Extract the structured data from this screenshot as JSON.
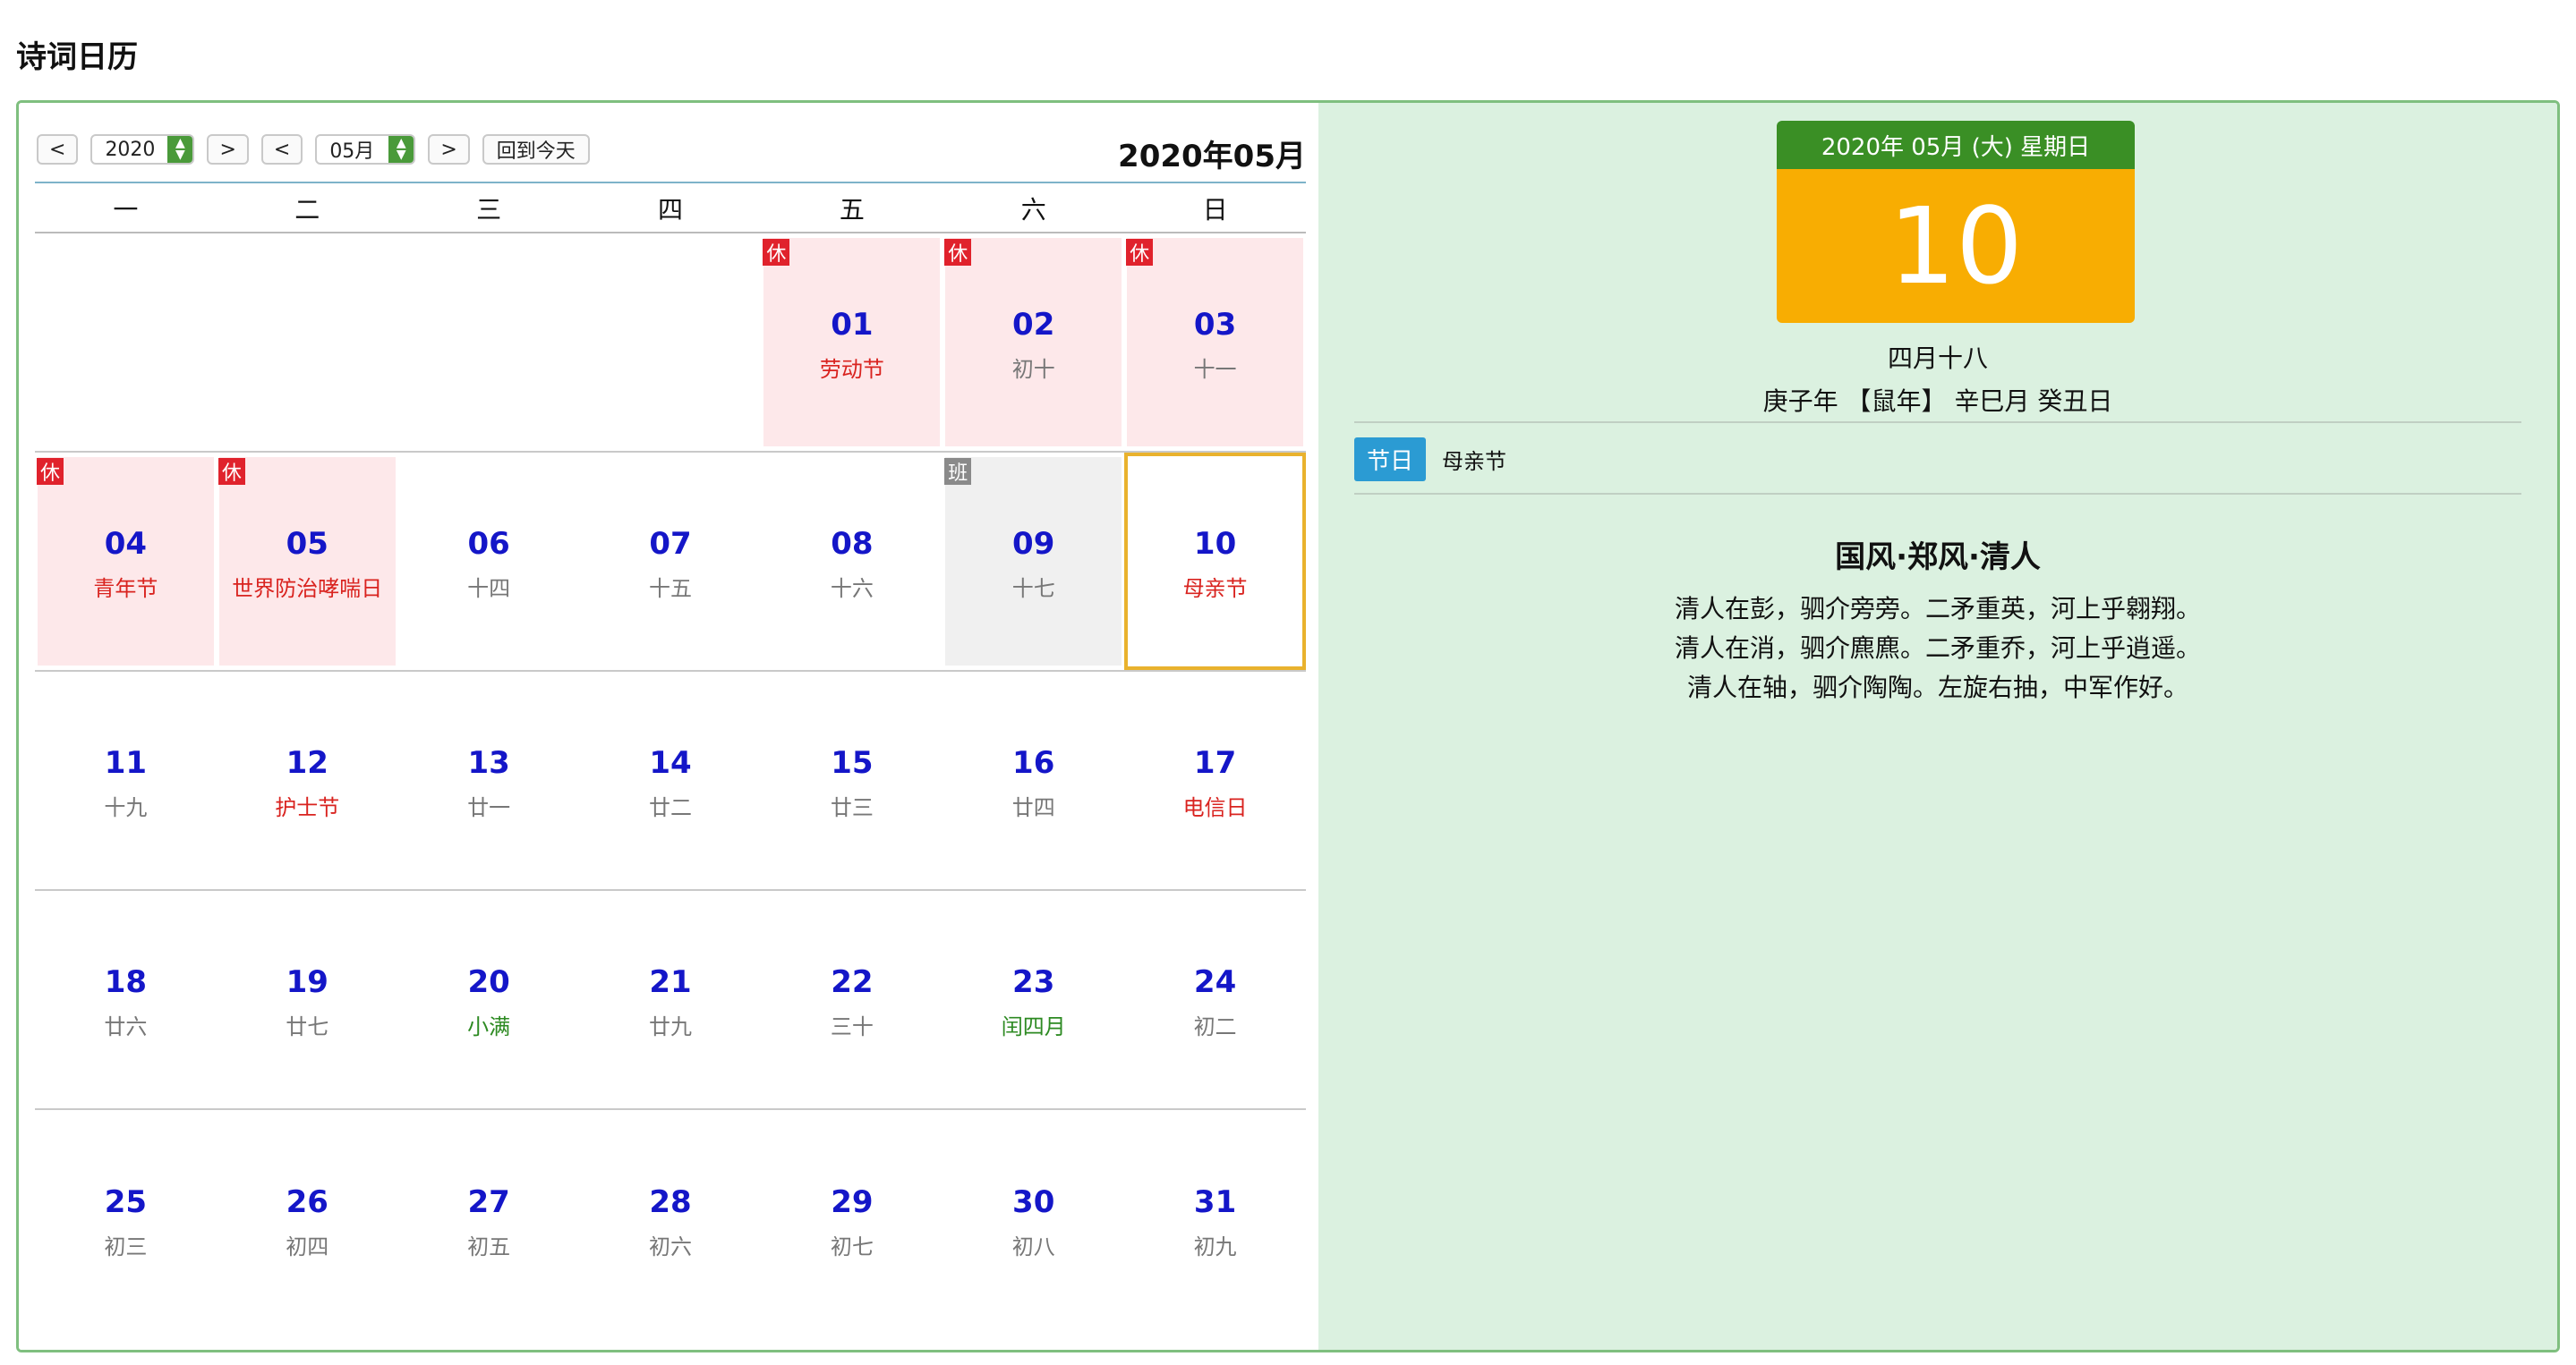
{
  "page": {
    "title": "诗词日历"
  },
  "toolbar": {
    "prev_year": "<",
    "year": "2020",
    "next_year": ">",
    "prev_month": "<",
    "month": "05月",
    "next_month": ">",
    "today": "回到今天"
  },
  "calendar": {
    "month_title": "2020年05月",
    "weekdays": [
      "一",
      "二",
      "三",
      "四",
      "五",
      "六",
      "日"
    ],
    "leading_blanks": 4,
    "days": [
      {
        "num": "01",
        "sub": "劳动节",
        "kind": "festival",
        "badge": "休",
        "mark": "rest"
      },
      {
        "num": "02",
        "sub": "初十",
        "kind": "lunar",
        "badge": "休",
        "mark": "rest"
      },
      {
        "num": "03",
        "sub": "十一",
        "kind": "lunar",
        "badge": "休",
        "mark": "rest"
      },
      {
        "num": "04",
        "sub": "青年节",
        "kind": "festival",
        "badge": "休",
        "mark": "rest"
      },
      {
        "num": "05",
        "sub": "世界防治哮喘日",
        "kind": "festival",
        "badge": "休",
        "mark": "rest"
      },
      {
        "num": "06",
        "sub": "十四",
        "kind": "lunar"
      },
      {
        "num": "07",
        "sub": "十五",
        "kind": "lunar"
      },
      {
        "num": "08",
        "sub": "十六",
        "kind": "lunar"
      },
      {
        "num": "09",
        "sub": "十七",
        "kind": "lunar",
        "badge": "班",
        "mark": "work"
      },
      {
        "num": "10",
        "sub": "母亲节",
        "kind": "festival",
        "selected": true
      },
      {
        "num": "11",
        "sub": "十九",
        "kind": "lunar"
      },
      {
        "num": "12",
        "sub": "护士节",
        "kind": "festival"
      },
      {
        "num": "13",
        "sub": "廿一",
        "kind": "lunar"
      },
      {
        "num": "14",
        "sub": "廿二",
        "kind": "lunar"
      },
      {
        "num": "15",
        "sub": "廿三",
        "kind": "lunar"
      },
      {
        "num": "16",
        "sub": "廿四",
        "kind": "lunar"
      },
      {
        "num": "17",
        "sub": "电信日",
        "kind": "festival"
      },
      {
        "num": "18",
        "sub": "廿六",
        "kind": "lunar"
      },
      {
        "num": "19",
        "sub": "廿七",
        "kind": "lunar"
      },
      {
        "num": "20",
        "sub": "小满",
        "kind": "term"
      },
      {
        "num": "21",
        "sub": "廿九",
        "kind": "lunar"
      },
      {
        "num": "22",
        "sub": "三十",
        "kind": "lunar"
      },
      {
        "num": "23",
        "sub": "闰四月",
        "kind": "term"
      },
      {
        "num": "24",
        "sub": "初二",
        "kind": "lunar"
      },
      {
        "num": "25",
        "sub": "初三",
        "kind": "lunar"
      },
      {
        "num": "26",
        "sub": "初四",
        "kind": "lunar"
      },
      {
        "num": "27",
        "sub": "初五",
        "kind": "lunar"
      },
      {
        "num": "28",
        "sub": "初六",
        "kind": "lunar"
      },
      {
        "num": "29",
        "sub": "初七",
        "kind": "lunar"
      },
      {
        "num": "30",
        "sub": "初八",
        "kind": "lunar"
      },
      {
        "num": "31",
        "sub": "初九",
        "kind": "lunar"
      }
    ]
  },
  "detail": {
    "header": "2020年 05月 (大) 星期日",
    "day": "10",
    "lunar": "四月十八",
    "ganzhi": "庚子年 【鼠年】 辛巳月 癸丑日",
    "festival_tag": "节日",
    "festival": "母亲节",
    "poem_title": "国风·郑风·清人",
    "poem_lines": [
      "清人在彭，驷介旁旁。二矛重英，河上乎翱翔。",
      "清人在消，驷介麃麃。二矛重乔，河上乎逍遥。",
      "清人在轴，驷介陶陶。左旋右抽，中军作好。"
    ]
  },
  "colors": {
    "accent_green": "#3a8f25",
    "accent_orange": "#f8ad02",
    "rest_red": "#e0222c",
    "day_blue": "#1416c8",
    "panel_bg": "#dbf1e0",
    "tag_blue": "#2b9bd3"
  }
}
